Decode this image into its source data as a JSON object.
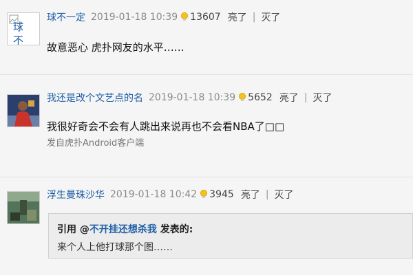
{
  "comments": [
    {
      "username": "球不一定",
      "time": "2019-01-18 10:39",
      "light_count": "13607",
      "light_label": "亮了",
      "dim_label": "灭了",
      "text": "故意恶心 虎扑网友的水平……",
      "avatar_alt": "球不",
      "avatar_icon": "broken-image-icon"
    },
    {
      "username": "我还是改个文艺点的名",
      "time": "2019-01-18 10:39",
      "light_count": "5652",
      "light_label": "亮了",
      "dim_label": "灭了",
      "text": "我很好奇会不会有人跳出来说再也不会看NBA了□□",
      "source": "发自虎扑Android客户端",
      "avatar_icon": "basketball-player-avatar"
    },
    {
      "username": "浮生曼珠沙华",
      "time": "2019-01-18 10:42",
      "light_count": "3945",
      "light_label": "亮了",
      "dim_label": "灭了",
      "quote": {
        "prefix": "引用 @",
        "user": "不开挂还想杀我",
        "suffix": " 发表的:",
        "text": "来个人上他打球那个图……"
      },
      "avatar_icon": "landscape-avatar"
    }
  ],
  "colors": {
    "username": "#1f5fa8",
    "background": "#f5f5f5",
    "quote_bg": "#ececec"
  }
}
